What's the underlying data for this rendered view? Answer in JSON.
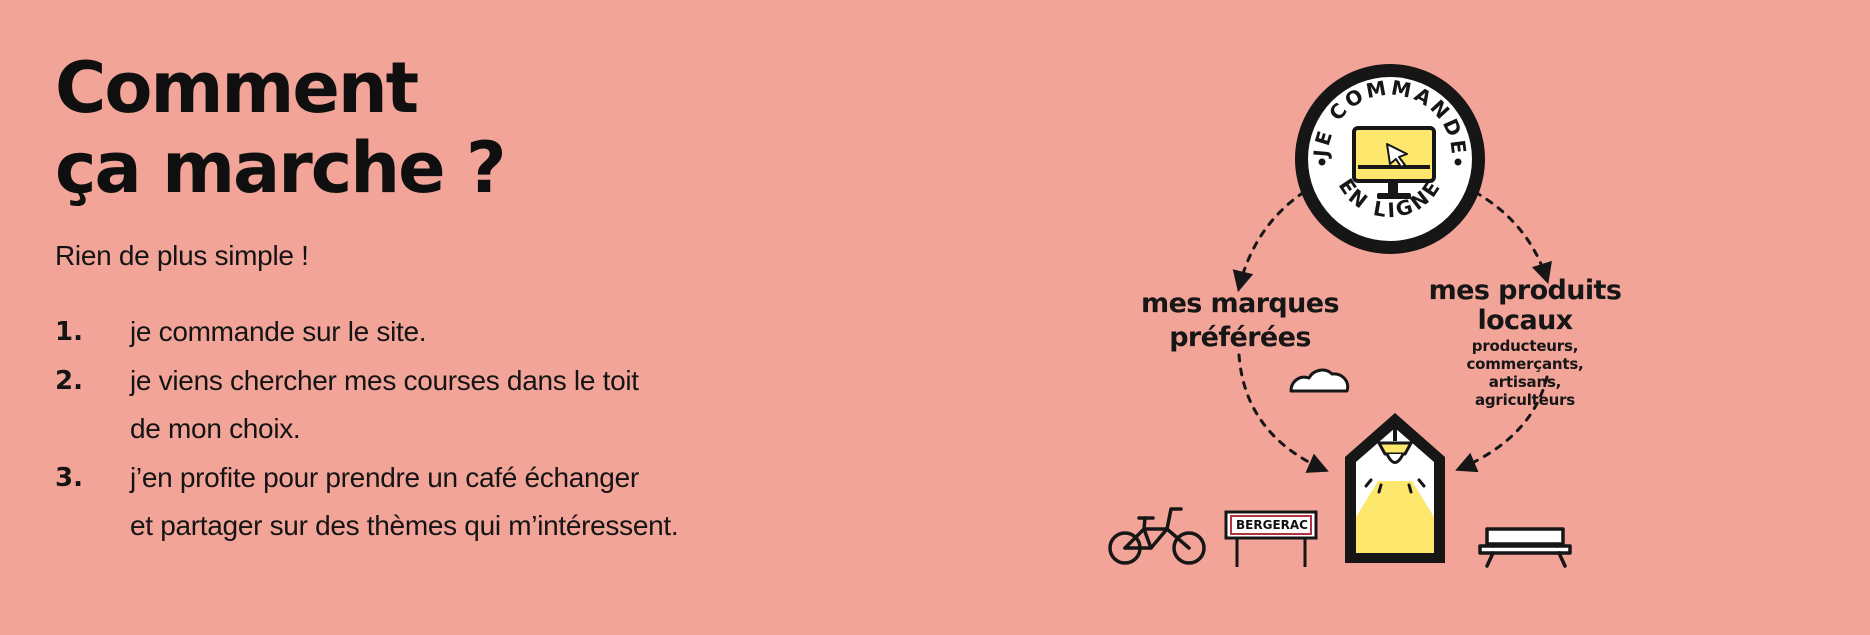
{
  "hero": {
    "title_line1": "Comment",
    "title_line2": "ça marche ?",
    "subtitle": "Rien de plus simple !"
  },
  "steps": [
    {
      "number": "1.",
      "lines": [
        "je commande sur le site."
      ]
    },
    {
      "number": "2.",
      "lines": [
        "je viens chercher mes courses dans le toit",
        "de mon choix."
      ]
    },
    {
      "number": "3.",
      "lines": [
        "j’en profite pour prendre un café échanger",
        "et partager sur des thèmes qui m’intéressent."
      ]
    }
  ],
  "diagram": {
    "badge_top": "JE COMMANDE",
    "badge_bottom": "EN LIGNE",
    "brands_line1": "mes marques",
    "brands_line2": "préférées",
    "local_line1": "mes produits",
    "local_line2": "locaux",
    "local_sub_line1": "producteurs, commerçants,",
    "local_sub_line2": "artisans, agriculteurs",
    "sign": "BERGERAC",
    "icons": {
      "badge": "online-order-badge-icon",
      "monitor": "monitor-icon",
      "cursor": "cursor-icon",
      "cloud": "cloud-icon",
      "house": "house-icon",
      "lamp": "lamp-icon",
      "bike": "bicycle-icon",
      "sign": "city-sign-icon",
      "bench": "bench-icon"
    }
  },
  "colors": {
    "background": "#f2a499",
    "ink": "#141414",
    "yellow": "#fde76c",
    "white": "#ffffff"
  }
}
